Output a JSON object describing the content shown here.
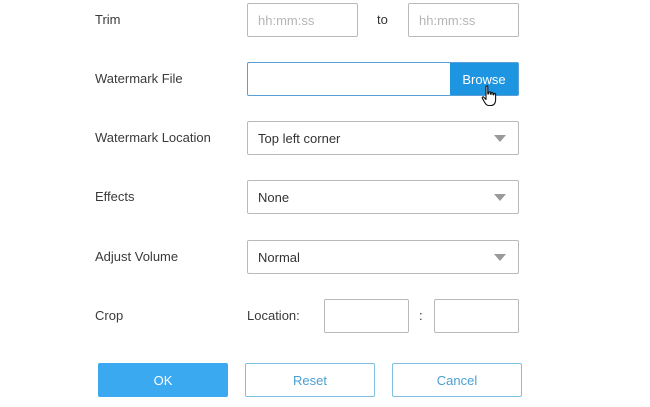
{
  "form": {
    "trim": {
      "label": "Trim",
      "start_placeholder": "hh:mm:ss",
      "end_placeholder": "hh:mm:ss",
      "start_value": "",
      "end_value": "",
      "separator": "to"
    },
    "watermark_file": {
      "label": "Watermark File",
      "value": "",
      "browse_label": "Browse"
    },
    "watermark_location": {
      "label": "Watermark Location",
      "selected": "Top left corner"
    },
    "effects": {
      "label": "Effects",
      "selected": "None"
    },
    "adjust_volume": {
      "label": "Adjust Volume",
      "selected": "Normal"
    },
    "crop": {
      "label": "Crop",
      "location_label": "Location:",
      "x_value": "",
      "y_value": "",
      "separator": ":"
    }
  },
  "actions": {
    "ok_label": "OK",
    "reset_label": "Reset",
    "cancel_label": "Cancel"
  },
  "colors": {
    "primary": "#3aa9ef",
    "browse": "#1e95e0",
    "outline_border": "#7fbfe0",
    "outline_text": "#4a9fd0"
  },
  "icons": {
    "cursor": "hand-pointer-icon",
    "dropdown": "caret-down-icon"
  }
}
